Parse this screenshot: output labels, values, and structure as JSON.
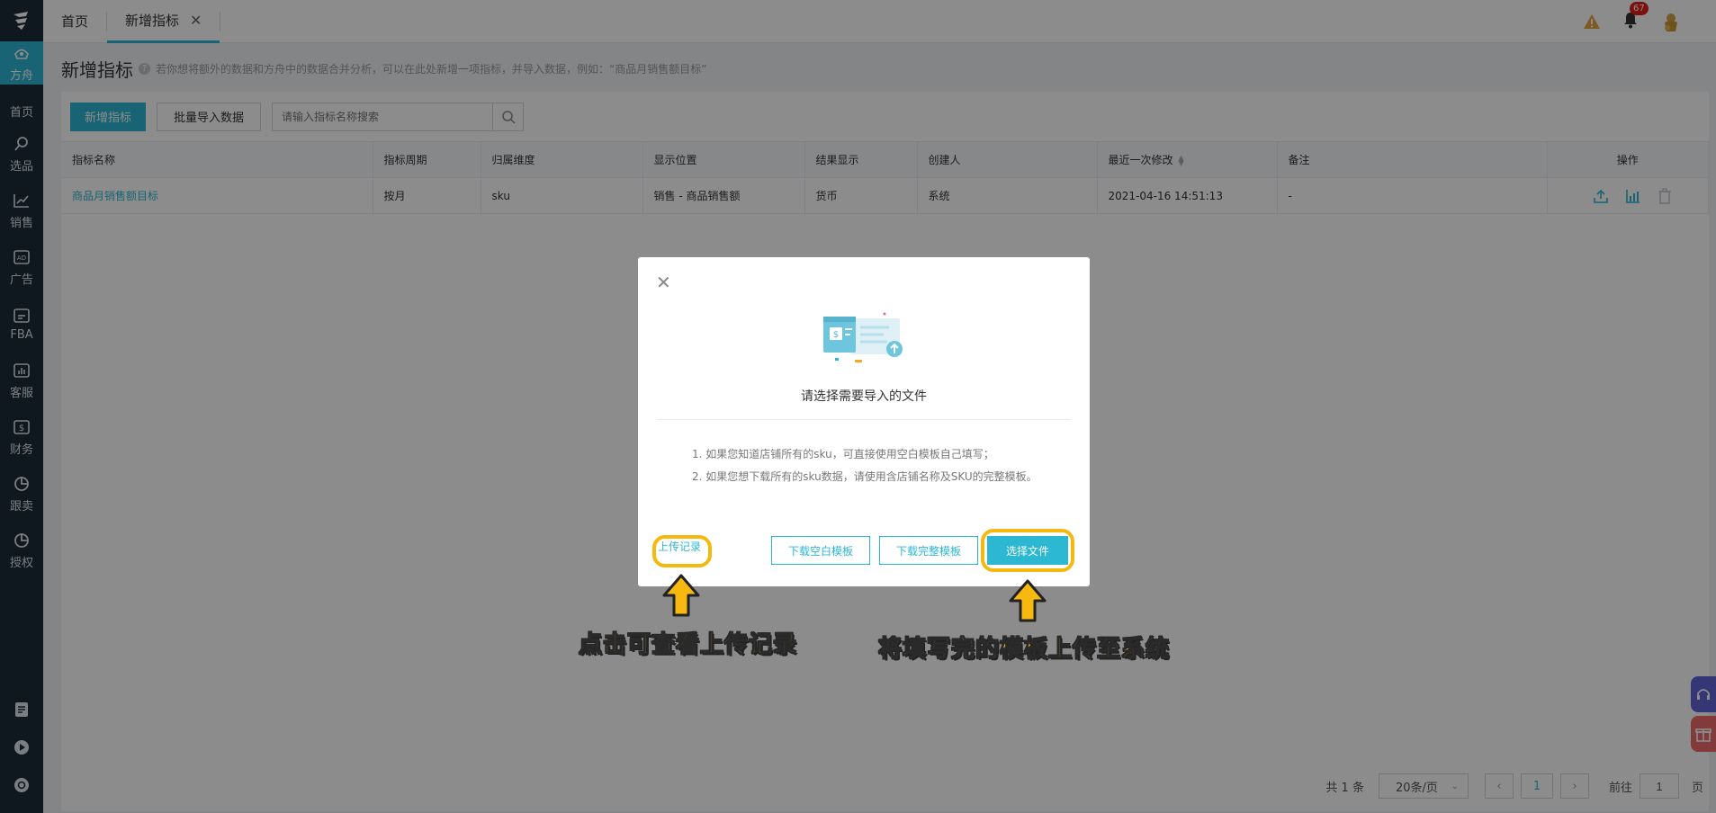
{
  "sidebar": {
    "items": [
      {
        "label": "方舟",
        "icon": "ark-icon",
        "active": true
      },
      {
        "label": "首页",
        "icon": "",
        "active": false
      },
      {
        "label": "选品",
        "icon": "search-icon",
        "active": false
      },
      {
        "label": "销售",
        "icon": "trend-icon",
        "active": false
      },
      {
        "label": "广告",
        "icon": "ad-icon",
        "active": false
      },
      {
        "label": "FBA",
        "icon": "fba-icon",
        "active": false
      },
      {
        "label": "客服",
        "icon": "chart-icon",
        "active": false
      },
      {
        "label": "财务",
        "icon": "dollar-icon",
        "active": false
      },
      {
        "label": "跟卖",
        "icon": "pie-icon",
        "active": false
      },
      {
        "label": "授权",
        "icon": "pie-icon",
        "active": false
      }
    ]
  },
  "tabs": [
    {
      "label": "首页"
    },
    {
      "label": "新增指标"
    }
  ],
  "header": {
    "badge_count": "67"
  },
  "page": {
    "title": "新增指标",
    "description": "若你想将额外的数据和方舟中的数据合并分析，可以在此处新增一项指标，并导入数据，例如：“商品月销售额目标”"
  },
  "toolbar": {
    "add_label": "新增指标",
    "batch_import_label": "批量导入数据",
    "search_placeholder": "请输入指标名称搜索"
  },
  "table": {
    "columns": [
      "指标名称",
      "指标周期",
      "归属维度",
      "显示位置",
      "结果显示",
      "创建人",
      "最近一次修改",
      "备注",
      "操作"
    ],
    "rows": [
      [
        "商品月销售额目标",
        "按月",
        "sku",
        "销售 - 商品销售额",
        "货币",
        "系统",
        "2021-04-16 14:51:13",
        "-"
      ]
    ]
  },
  "pager": {
    "total": "共 1 条",
    "page_size": "20条/页",
    "current": "1",
    "goto_prefix": "前往",
    "goto_value": "1",
    "goto_suffix": "页"
  },
  "modal": {
    "title": "请选择需要导入的文件",
    "tip1": "1. 如果您知道店铺所有的sku，可直接使用空白模板自己填写；",
    "tip2": "2. 如果您想下载所有的sku数据，请使用含店铺名称及SKU的完整模板。",
    "upload_record": "上传记录",
    "download_blank": "下载空白模板",
    "download_full": "下载完整模板",
    "choose_file": "选择文件"
  },
  "annotations": {
    "left": "点击可查看上传记录",
    "right": "将填写完的模板上传至系统"
  },
  "colors": {
    "accent": "#2cb7d3",
    "sidebar": "#1d2b3a",
    "highlight": "#f5b80f"
  }
}
